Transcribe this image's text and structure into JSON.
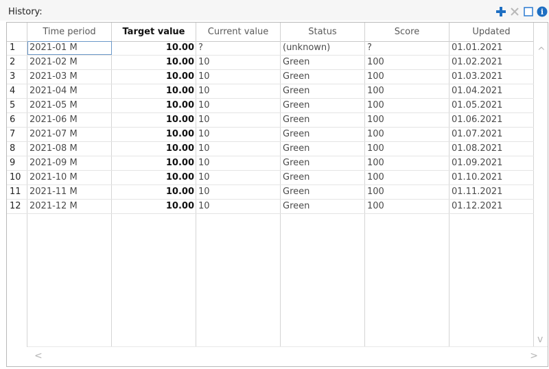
{
  "panel": {
    "title": "History:"
  },
  "toolbar": {
    "add_icon": "plus-icon",
    "delete_icon": "x-icon",
    "square_icon": "square-icon",
    "info_icon": "info-icon",
    "info_glyph": "i",
    "colors": {
      "add": "#1e6fc2",
      "delete": "#b8b8b8",
      "square": "#2a7ad0",
      "info": "#1e6fc2"
    }
  },
  "table": {
    "columns": [
      "Time period",
      "Target value",
      "Current value",
      "Status",
      "Score",
      "Updated"
    ],
    "rows": [
      {
        "num": "1",
        "period": "2021-01 M",
        "target": "10.00",
        "current": "?",
        "status": "(unknown)",
        "score": "?",
        "updated": "01.01.2021"
      },
      {
        "num": "2",
        "period": "2021-02 M",
        "target": "10.00",
        "current": "10",
        "status": "Green",
        "score": "100",
        "updated": "01.02.2021"
      },
      {
        "num": "3",
        "period": "2021-03 M",
        "target": "10.00",
        "current": "10",
        "status": "Green",
        "score": "100",
        "updated": "01.03.2021"
      },
      {
        "num": "4",
        "period": "2021-04 M",
        "target": "10.00",
        "current": "10",
        "status": "Green",
        "score": "100",
        "updated": "01.04.2021"
      },
      {
        "num": "5",
        "period": "2021-05 M",
        "target": "10.00",
        "current": "10",
        "status": "Green",
        "score": "100",
        "updated": "01.05.2021"
      },
      {
        "num": "6",
        "period": "2021-06 M",
        "target": "10.00",
        "current": "10",
        "status": "Green",
        "score": "100",
        "updated": "01.06.2021"
      },
      {
        "num": "7",
        "period": "2021-07 M",
        "target": "10.00",
        "current": "10",
        "status": "Green",
        "score": "100",
        "updated": "01.07.2021"
      },
      {
        "num": "8",
        "period": "2021-08 M",
        "target": "10.00",
        "current": "10",
        "status": "Green",
        "score": "100",
        "updated": "01.08.2021"
      },
      {
        "num": "9",
        "period": "2021-09 M",
        "target": "10.00",
        "current": "10",
        "status": "Green",
        "score": "100",
        "updated": "01.09.2021"
      },
      {
        "num": "10",
        "period": "2021-10 M",
        "target": "10.00",
        "current": "10",
        "status": "Green",
        "score": "100",
        "updated": "01.10.2021"
      },
      {
        "num": "11",
        "period": "2021-11 M",
        "target": "10.00",
        "current": "10",
        "status": "Green",
        "score": "100",
        "updated": "01.11.2021"
      },
      {
        "num": "12",
        "period": "2021-12 M",
        "target": "10.00",
        "current": "10",
        "status": "Green",
        "score": "100",
        "updated": "01.12.2021"
      }
    ]
  },
  "scrollbars": {
    "up_arrow": "^",
    "down_arrow": "v",
    "left_arrow": "<",
    "right_arrow": ">"
  }
}
